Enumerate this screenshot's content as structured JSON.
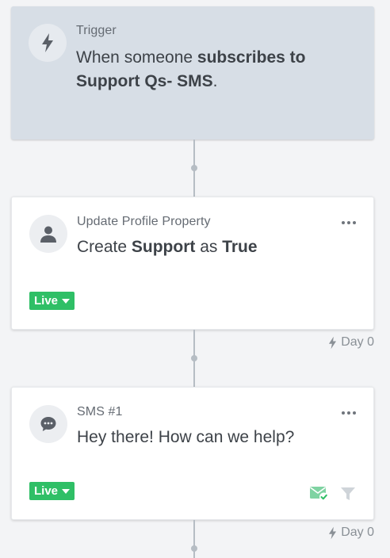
{
  "trigger": {
    "label": "Trigger",
    "text_prefix": "When someone ",
    "text_bold": "subscribes to Support Qs- SMS",
    "text_suffix": "."
  },
  "steps": [
    {
      "label": "Update Profile Property",
      "text_prefix": "Create ",
      "text_bold_1": "Support",
      "text_middle": " as ",
      "text_bold_2": "True",
      "status": "Live",
      "icon": "person-icon"
    },
    {
      "label": "SMS #1",
      "text": "Hey there! How can we help?",
      "status": "Live",
      "icon": "chat-bubble-icon"
    }
  ],
  "delays": [
    {
      "label": "Day 0"
    },
    {
      "label": "Day 0"
    }
  ],
  "colors": {
    "live_badge": "#2fbf66",
    "trigger_card": "#d7dee6",
    "connector": "#b6bdc4"
  }
}
